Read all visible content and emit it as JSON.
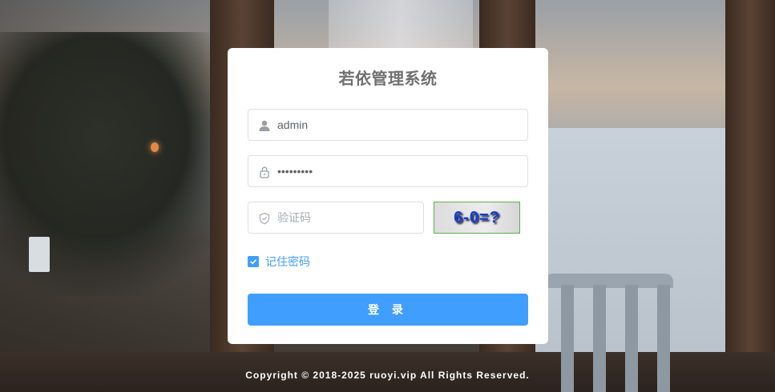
{
  "login": {
    "title": "若依管理系统",
    "username": {
      "value": "admin",
      "icon": "user-icon"
    },
    "password": {
      "value": "•••••••••",
      "icon": "lock-icon"
    },
    "captcha": {
      "placeholder": "验证码",
      "icon": "shield-icon",
      "image_text": "6-0=?"
    },
    "remember": {
      "label": "记住密码",
      "checked": true
    },
    "submit_label": "登 录"
  },
  "footer": {
    "copyright": "Copyright © 2018-2025 ruoyi.vip All Rights Reserved."
  },
  "colors": {
    "primary": "#409eff",
    "card": "#ffffff",
    "border": "#dcdfe6",
    "captcha_text": "#1440c8"
  }
}
